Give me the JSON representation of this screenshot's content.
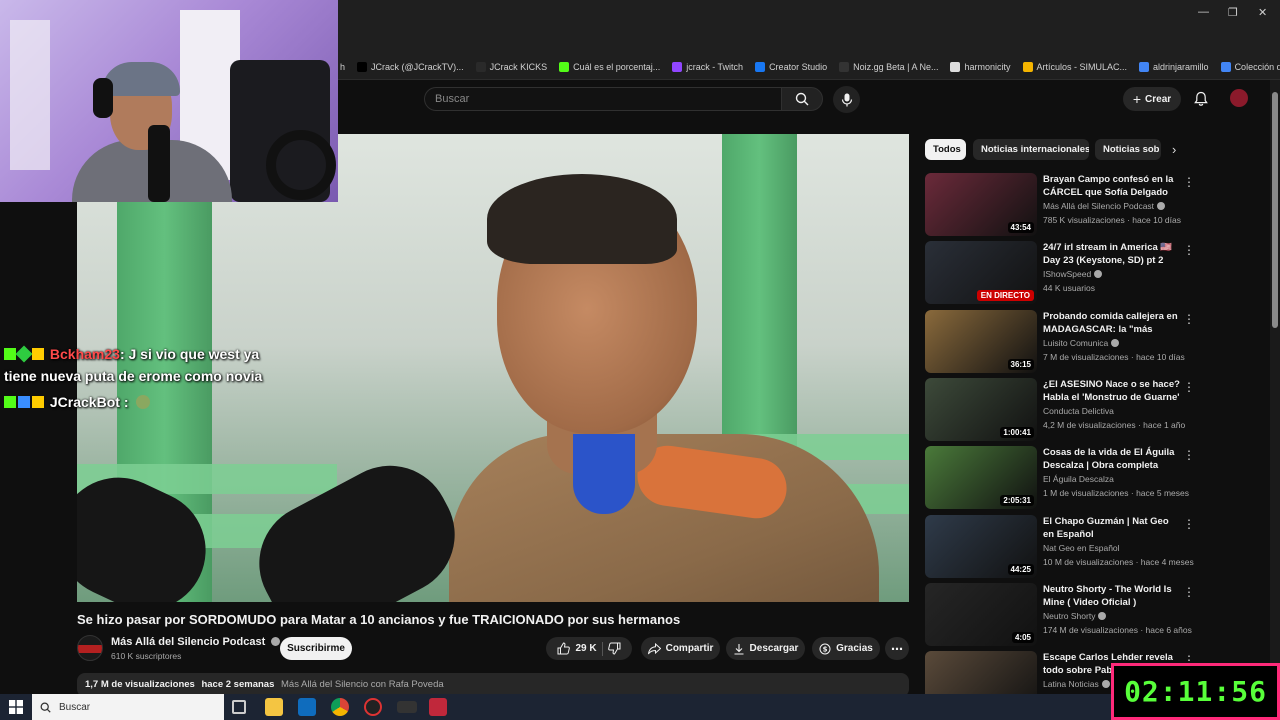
{
  "browser": {
    "bookmarks": [
      {
        "label": "h",
        "icon": "bookmark-icon",
        "color": "#444"
      },
      {
        "label": "JCrack (@JCrackTV)...",
        "icon": "x-icon",
        "color": "#000"
      },
      {
        "label": "JCrack KICKS",
        "icon": "twitch-icon",
        "color": "#2a2a2a"
      },
      {
        "label": "Cuál es el porcentaj...",
        "icon": "kick-icon",
        "color": "#53fc18"
      },
      {
        "label": "jcrack - Twitch",
        "icon": "twitch-icon",
        "color": "#9146ff"
      },
      {
        "label": "Creator Studio",
        "icon": "facebook-icon",
        "color": "#1877f2"
      },
      {
        "label": "Noiz.gg Beta | A Ne...",
        "icon": "noiz-icon",
        "color": "#333"
      },
      {
        "label": "harmonicity",
        "icon": "doc-icon",
        "color": "#ddd"
      },
      {
        "label": "Artículos - SIMULAC...",
        "icon": "drive-icon",
        "color": "#f4b400"
      },
      {
        "label": "aldrinjaramillo",
        "icon": "doc-icon",
        "color": "#4285f4"
      },
      {
        "label": "Colección de M_blei...",
        "icon": "doc-icon",
        "color": "#4285f4"
      }
    ]
  },
  "header": {
    "search_placeholder": "Buscar",
    "create_label": "Crear"
  },
  "chat": [
    {
      "user": "Bckham23",
      "user_color": "#ff4a4a",
      "message": ": J si vio que west ya"
    },
    {
      "user": "",
      "user_color": "#ffffff",
      "message": "tiene nueva puta de erome como novia"
    },
    {
      "user": "JCrackBot",
      "user_color": "#ffffff",
      "message": ":"
    }
  ],
  "video": {
    "title": "Se hizo pasar por SORDOMUDO para Matar a 10 ancianos y fue TRAICIONADO por sus hermanos",
    "channel": "Más Allá del Silencio Podcast",
    "subscribers": "610 K suscriptores",
    "subscribe_label": "Suscribirme",
    "likes": "29 K",
    "share_label": "Compartir",
    "download_label": "Descargar",
    "thanks_label": "Gracias",
    "views": "1,7 M de visualizaciones",
    "age": "hace 2 semanas",
    "desc_tail": "Más Allá del Silencio con Rafa Poveda"
  },
  "chips": [
    "Todos",
    "Noticias internacionales",
    "Noticias sob"
  ],
  "recommendations": [
    {
      "title": "Brayan Campo confesó en la CÁRCEL que Sofía Delgado N...",
      "channel": "Más Allá del Silencio Podcast",
      "verified": true,
      "meta": "785 K visualizaciones · hace 10 días",
      "duration": "43:54",
      "thumb": "#6b2a3a"
    },
    {
      "title": "24/7 irl stream in America 🇺🇸 Day 23 (Keystone, SD) pt 2",
      "channel": "IShowSpeed",
      "verified": true,
      "meta": "44 K usuarios",
      "live": "EN DIRECTO",
      "thumb": "#2a2f38"
    },
    {
      "title": "Probando comida callejera en MADAGASCAR: la \"más barata...",
      "channel": "Luisito Comunica",
      "verified": true,
      "meta": "7 M de visualizaciones · hace 10 días",
      "duration": "36:15",
      "thumb": "#8a6a3c"
    },
    {
      "title": "¿El ASESINO Nace o se hace? Habla el 'Monstruo de Guarne'",
      "channel": "Conducta Delictiva",
      "verified": false,
      "meta": "4,2 M de visualizaciones · hace 1 año",
      "duration": "1:00:41",
      "thumb": "#3d4a3a"
    },
    {
      "title": "Cosas de la vida de El Águila Descalza | Obra completa",
      "channel": "El Águila Descalza",
      "verified": false,
      "meta": "1 M de visualizaciones · hace 5 meses",
      "duration": "2:05:31",
      "thumb": "#4a7a3a"
    },
    {
      "title": "El Chapo Guzmán | Nat Geo en Español",
      "channel": "Nat Geo en Español",
      "verified": false,
      "meta": "10 M de visualizaciones · hace 4 meses",
      "duration": "44:25",
      "thumb": "#2f3b4a"
    },
    {
      "title": "Neutro Shorty - The World Is Mine ( Video Oficial )",
      "channel": "Neutro Shorty",
      "verified": true,
      "meta": "174 M de visualizaciones · hace 6 años",
      "duration": "4:05",
      "thumb": "#262626"
    },
    {
      "title": "Escape Carlos Lehder revela todo sobre Pablo Escobar y el...",
      "channel": "Latina Noticias",
      "verified": true,
      "meta": "",
      "duration": "",
      "thumb": "#5a4a3a"
    }
  ],
  "taskbar": {
    "search_label": "Buscar"
  },
  "timer": "02:11:56"
}
